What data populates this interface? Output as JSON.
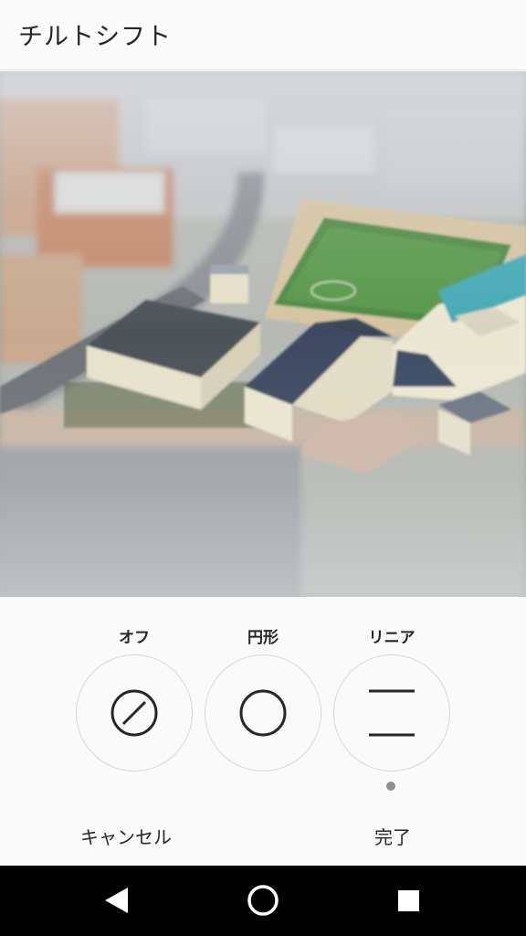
{
  "header": {
    "title": "チルトシフト"
  },
  "photo": {
    "description_icon": "tilt-shift-photo"
  },
  "options": [
    {
      "label": "オフ",
      "icon": "off-icon",
      "selected": false
    },
    {
      "label": "円形",
      "icon": "circle-icon",
      "selected": false
    },
    {
      "label": "リニア",
      "icon": "linear-icon",
      "selected": true
    }
  ],
  "actions": {
    "cancel": "キャンセル",
    "done": "完了"
  },
  "colors": {
    "text": "#262626",
    "border": "#d6d6d6",
    "dot": "#8e8e8e",
    "nav": "#000000"
  }
}
